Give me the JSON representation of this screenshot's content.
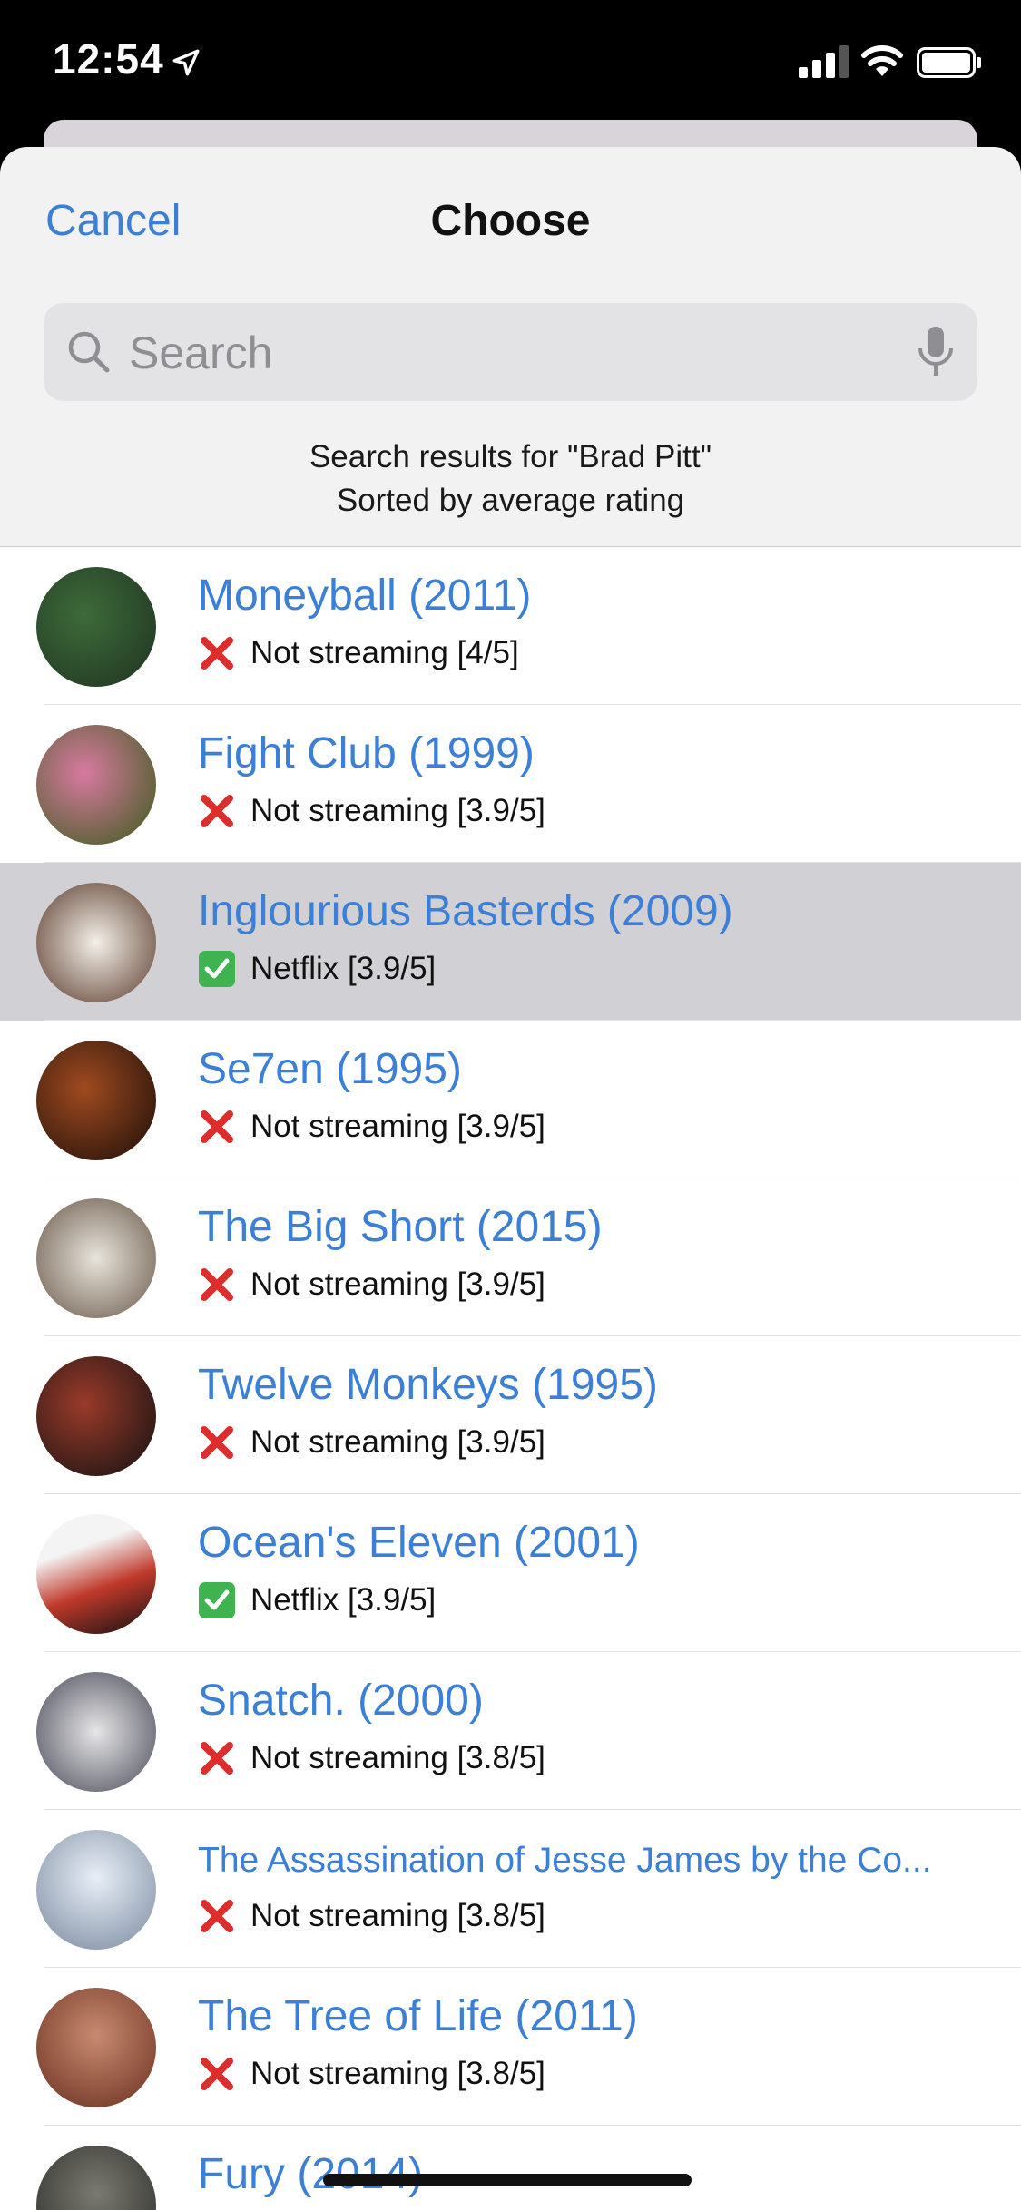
{
  "status_bar": {
    "time": "12:54"
  },
  "nav": {
    "cancel_label": "Cancel",
    "title": "Choose"
  },
  "search": {
    "placeholder": "Search",
    "value": ""
  },
  "caption": {
    "line1": "Search results for \"Brad Pitt\"",
    "line2": "Sorted by average rating"
  },
  "colors": {
    "accent": "#3b7fd6",
    "selected_row": "#d1d1d5",
    "sheet_bg": "#f2f2f3"
  },
  "movies": [
    {
      "title": "Moneyball (2011)",
      "status_icon": "cross-icon",
      "streaming": "Not streaming [4/5]",
      "selected": false
    },
    {
      "title": "Fight Club (1999)",
      "status_icon": "cross-icon",
      "streaming": "Not streaming [3.9/5]",
      "selected": false
    },
    {
      "title": "Inglourious Basterds (2009)",
      "status_icon": "check-icon",
      "streaming": "Netflix [3.9/5]",
      "selected": true
    },
    {
      "title": "Se7en (1995)",
      "status_icon": "cross-icon",
      "streaming": "Not streaming [3.9/5]",
      "selected": false
    },
    {
      "title": "The Big Short (2015)",
      "status_icon": "cross-icon",
      "streaming": "Not streaming [3.9/5]",
      "selected": false
    },
    {
      "title": "Twelve Monkeys (1995)",
      "status_icon": "cross-icon",
      "streaming": "Not streaming [3.9/5]",
      "selected": false
    },
    {
      "title": "Ocean's Eleven (2001)",
      "status_icon": "check-icon",
      "streaming": "Netflix [3.9/5]",
      "selected": false
    },
    {
      "title": "Snatch. (2000)",
      "status_icon": "cross-icon",
      "streaming": "Not streaming [3.8/5]",
      "selected": false
    },
    {
      "title": "The Assassination of Jesse James by the Co...",
      "status_icon": "cross-icon",
      "streaming": "Not streaming [3.8/5]",
      "selected": false
    },
    {
      "title": "The Tree of Life (2011)",
      "status_icon": "cross-icon",
      "streaming": "Not streaming [3.8/5]",
      "selected": false
    },
    {
      "title": "Fury (2014)",
      "status_icon": "cross-icon",
      "streaming": "",
      "selected": false
    }
  ]
}
